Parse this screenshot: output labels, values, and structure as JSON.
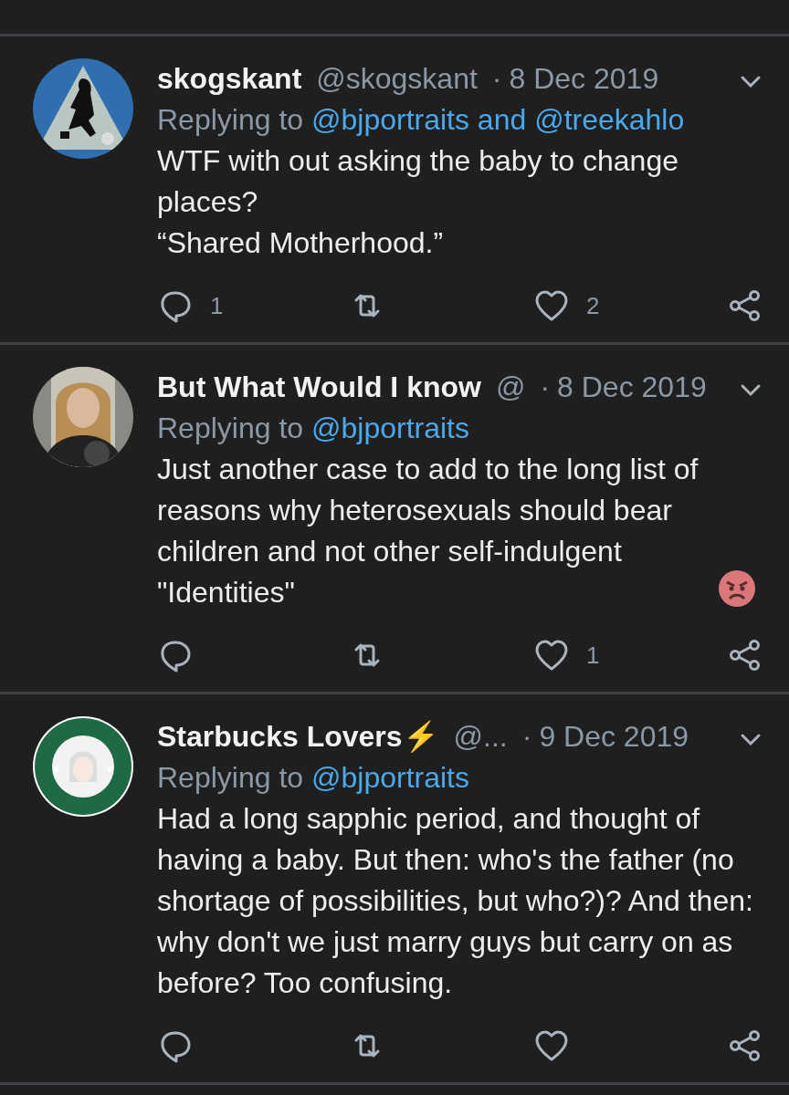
{
  "tweets": [
    {
      "name": "skogskant",
      "handle": "@skogskant",
      "separator": "·",
      "date": "8 Dec 2019",
      "replying_label": "Replying to",
      "reply_to": "@bjportraits and @treekahlo",
      "paragraphs": [
        "WTF with out asking the baby to change places?",
        "“Shared Motherhood.”"
      ],
      "reply_count": "1",
      "like_count": "2"
    },
    {
      "name": "But What Would I know",
      "handle": "@",
      "separator": "·",
      "date": "8 Dec 2019",
      "replying_label": "Replying to",
      "reply_to": "@bjportraits",
      "paragraphs": [
        "Just another case to add to the long list of reasons why heterosexuals should bear children and not other self-indulgent \"Identities\""
      ],
      "trailing_emoji": true,
      "like_count": "1"
    },
    {
      "name": "Starbucks Lovers⚡",
      "handle": "@...",
      "separator": "·",
      "date": "9 Dec 2019",
      "replying_label": "Replying to",
      "reply_to": "@bjportraits",
      "paragraphs": [
        "Had a long sapphic period, and thought of having a baby. But then: who's the father (no shortage of possibilities, but who?)? And then: why don't we just marry guys but carry on as before? Too confusing."
      ]
    }
  ]
}
